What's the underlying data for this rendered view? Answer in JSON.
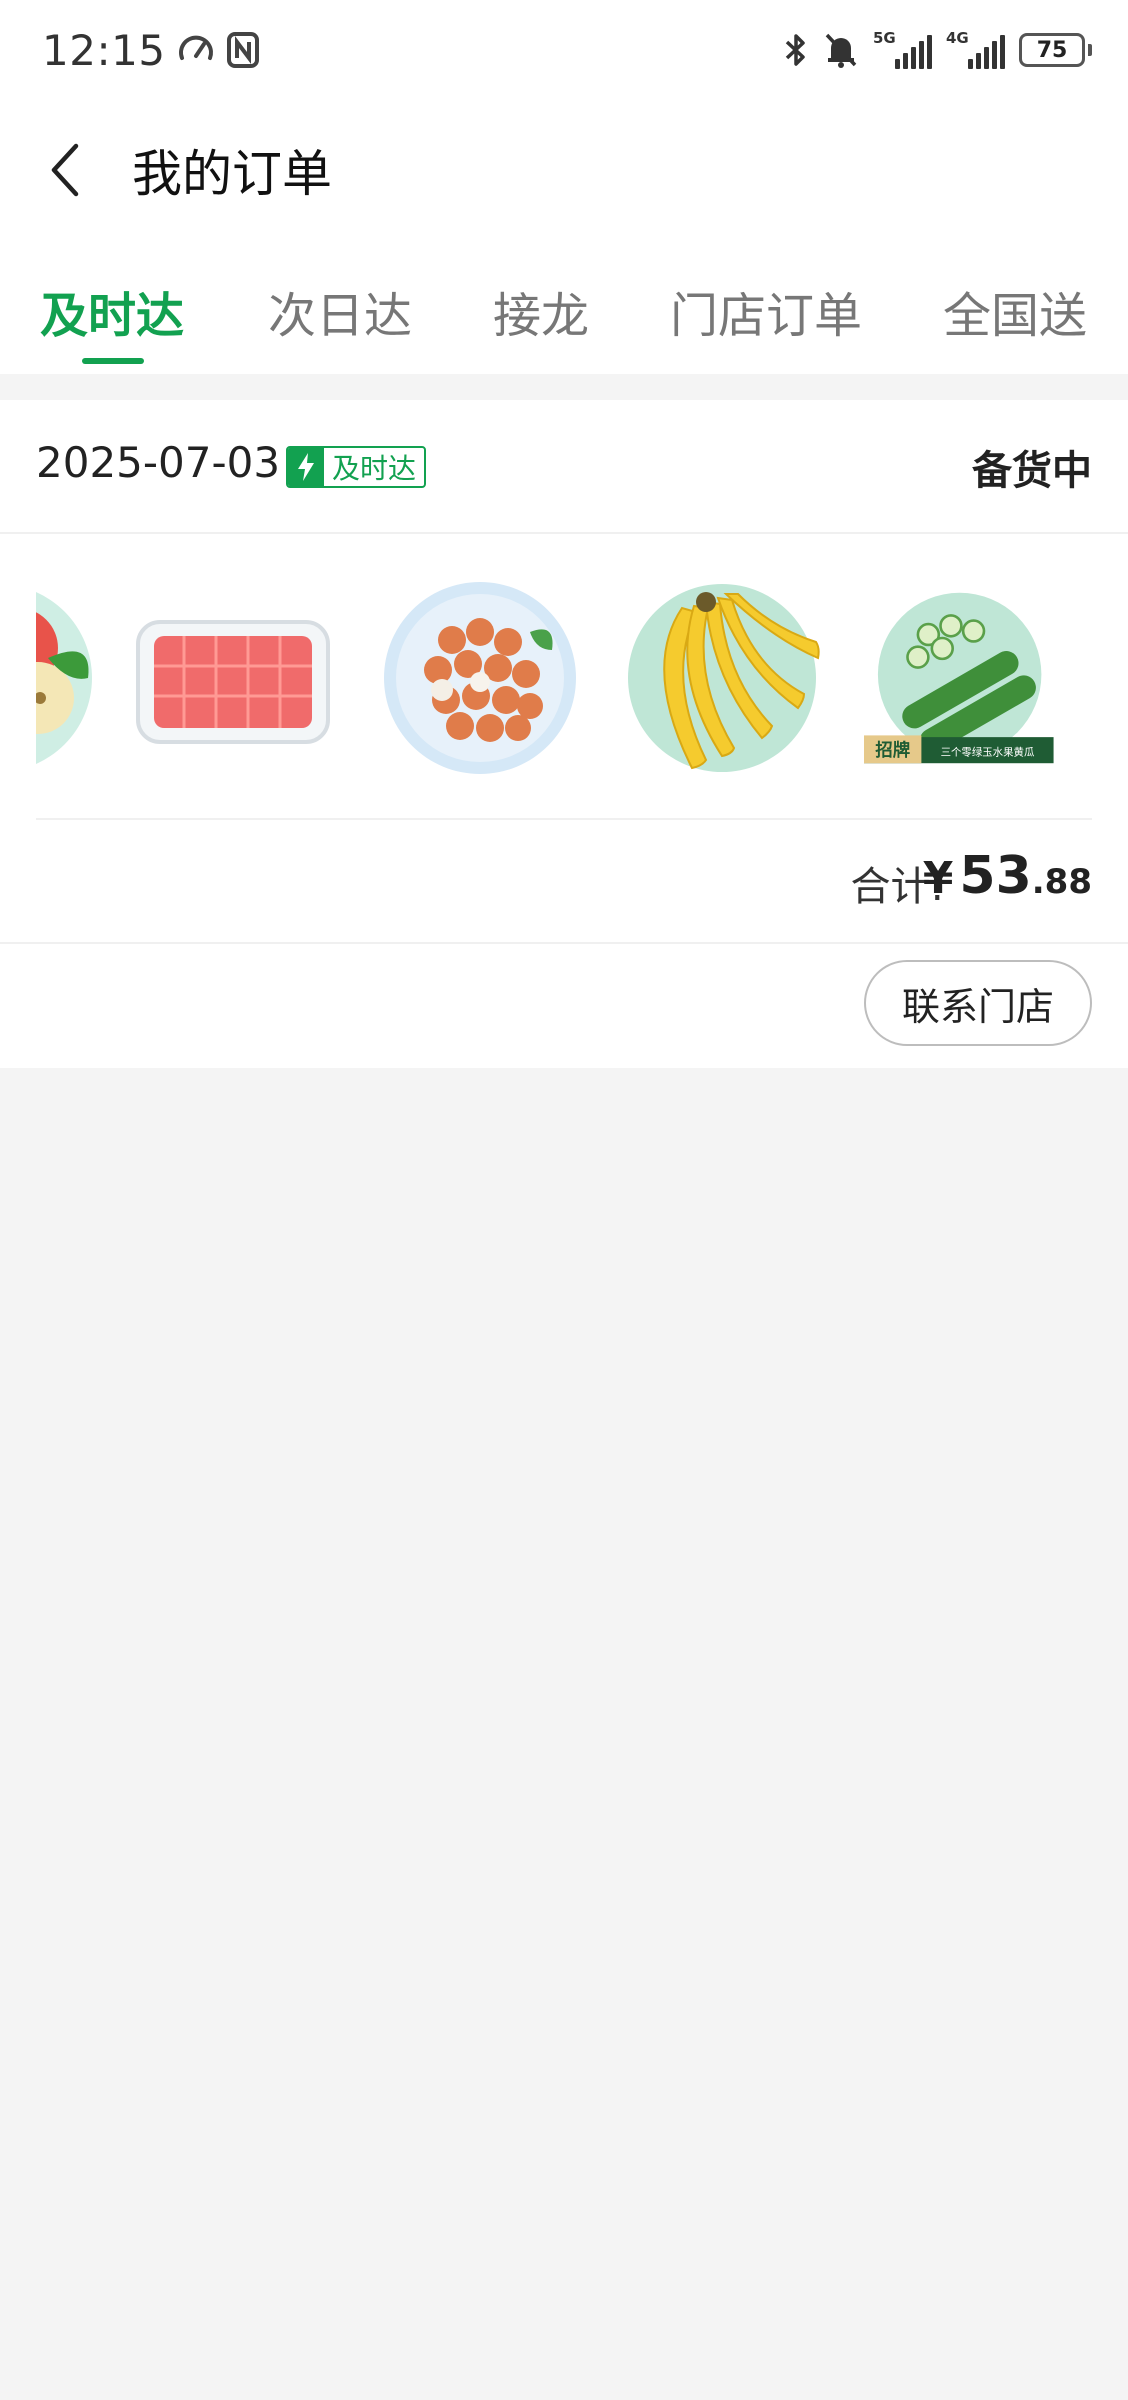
{
  "status_bar": {
    "time": "12:15",
    "net1": "5G",
    "net2": "4G",
    "battery": "75"
  },
  "header": {
    "title": "我的订单"
  },
  "tabs": [
    {
      "label": "及时达",
      "active": true
    },
    {
      "label": "次日达",
      "active": false
    },
    {
      "label": "接龙",
      "active": false
    },
    {
      "label": "门店订单",
      "active": false
    },
    {
      "label": "全国送",
      "active": false
    }
  ],
  "order": {
    "date": "2025-07-03",
    "badge": "及时达",
    "status": "备货中",
    "products": [
      {
        "name": "apple"
      },
      {
        "name": "watermelon"
      },
      {
        "name": "lychee"
      },
      {
        "name": "banana"
      },
      {
        "name": "cucumber",
        "tag": "招牌",
        "caption": "三个零绿玉水果黄瓜"
      }
    ],
    "total_label": "合计:",
    "currency": "¥",
    "total_int": "53",
    "total_dec": ".88",
    "contact_button": "联系门店"
  },
  "colors": {
    "accent": "#12a150",
    "background": "#f4f4f4"
  }
}
